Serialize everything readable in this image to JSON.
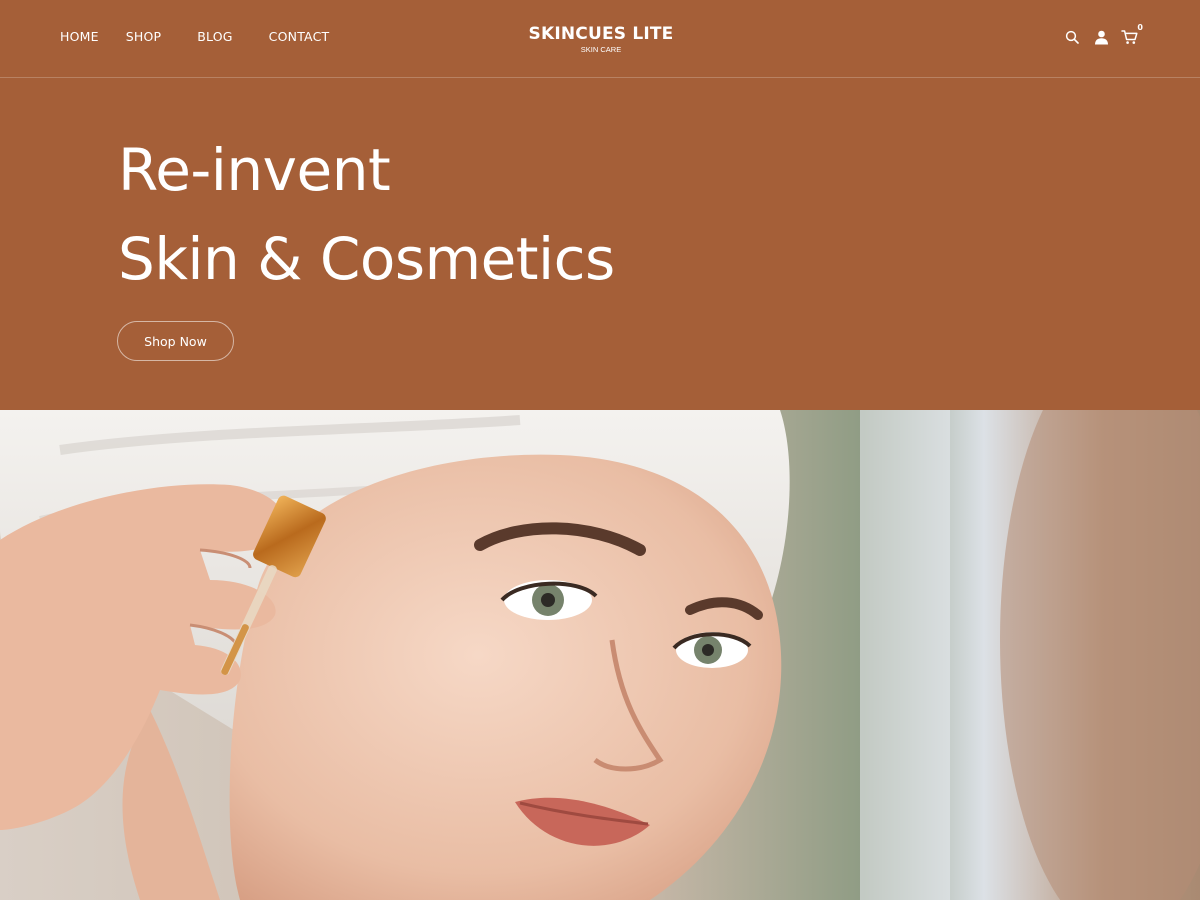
{
  "nav": {
    "items": [
      {
        "label": "HOME"
      },
      {
        "label": "SHOP"
      },
      {
        "label": "BLOG"
      },
      {
        "label": "CONTACT"
      }
    ]
  },
  "brand": {
    "title": "SKINCUES LITE",
    "tagline": "SKIN CARE"
  },
  "header_icons": {
    "search": "search-icon",
    "account": "user-icon",
    "cart": "cart-icon",
    "cart_count": "0"
  },
  "hero": {
    "line1": "Re-invent",
    "line2": "Skin & Cosmetics",
    "cta_label": "Shop Now"
  },
  "colors": {
    "brand_brown": "#a55f38",
    "text": "#ffffff"
  }
}
